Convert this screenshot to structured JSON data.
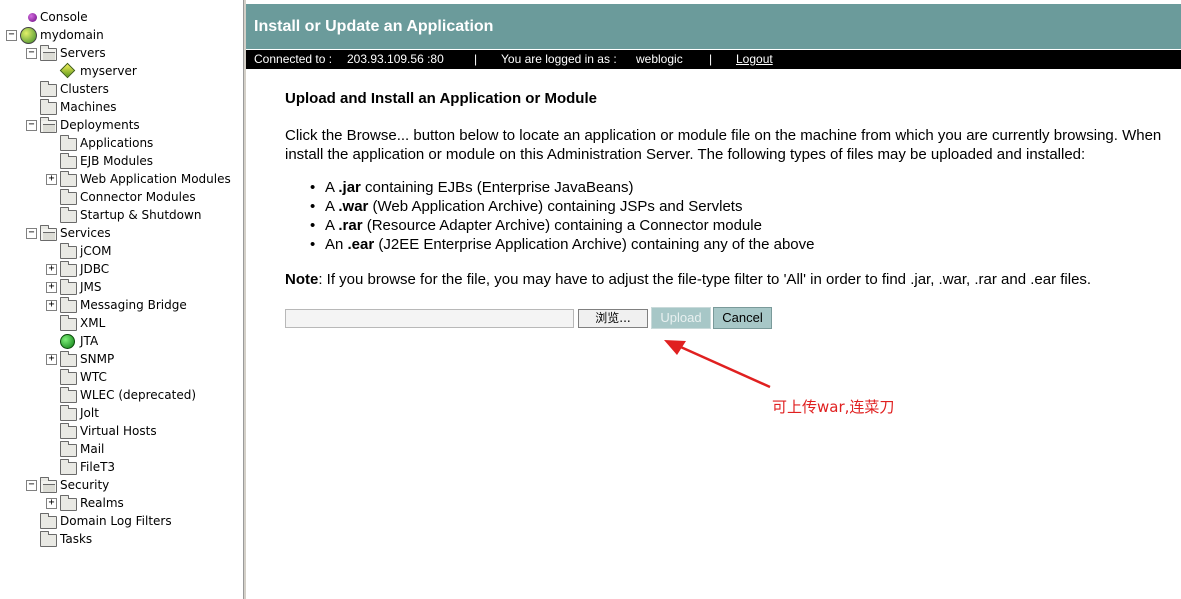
{
  "tree": {
    "items": [
      {
        "label": "Console",
        "icon": "console-dot-icon",
        "toggle": ""
      },
      {
        "label": "mydomain",
        "icon": "domain-globe-icon",
        "toggle": "⊟"
      },
      {
        "label": "Servers",
        "icon": "folder-open-icon",
        "toggle": "⊟"
      },
      {
        "label": "myserver",
        "icon": "server-diamond-icon",
        "toggle": ""
      },
      {
        "label": "Clusters",
        "icon": "folder-icon",
        "toggle": ""
      },
      {
        "label": "Machines",
        "icon": "folder-icon",
        "toggle": ""
      },
      {
        "label": "Deployments",
        "icon": "folder-open-icon",
        "toggle": "⊟"
      },
      {
        "label": "Applications",
        "icon": "folder-icon",
        "toggle": ""
      },
      {
        "label": "EJB Modules",
        "icon": "folder-icon",
        "toggle": ""
      },
      {
        "label": "Web Application Modules",
        "icon": "folder-icon",
        "toggle": "⊞"
      },
      {
        "label": "Connector Modules",
        "icon": "folder-icon",
        "toggle": ""
      },
      {
        "label": "Startup & Shutdown",
        "icon": "folder-icon",
        "toggle": ""
      },
      {
        "label": "Services",
        "icon": "folder-open-icon",
        "toggle": "⊟"
      },
      {
        "label": "jCOM",
        "icon": "folder-icon",
        "toggle": ""
      },
      {
        "label": "JDBC",
        "icon": "folder-icon",
        "toggle": "⊞"
      },
      {
        "label": "JMS",
        "icon": "folder-icon",
        "toggle": "⊞"
      },
      {
        "label": "Messaging Bridge",
        "icon": "folder-icon",
        "toggle": "⊞"
      },
      {
        "label": "XML",
        "icon": "folder-icon",
        "toggle": ""
      },
      {
        "label": "JTA",
        "icon": "green-ball-icon",
        "toggle": ""
      },
      {
        "label": "SNMP",
        "icon": "folder-icon",
        "toggle": "⊞"
      },
      {
        "label": "WTC",
        "icon": "folder-icon",
        "toggle": ""
      },
      {
        "label": "WLEC (deprecated)",
        "icon": "folder-icon",
        "toggle": ""
      },
      {
        "label": "Jolt",
        "icon": "folder-icon",
        "toggle": ""
      },
      {
        "label": "Virtual Hosts",
        "icon": "folder-icon",
        "toggle": ""
      },
      {
        "label": "Mail",
        "icon": "folder-icon",
        "toggle": ""
      },
      {
        "label": "FileT3",
        "icon": "folder-icon",
        "toggle": ""
      },
      {
        "label": "Security",
        "icon": "folder-open-icon",
        "toggle": "⊟"
      },
      {
        "label": "Realms",
        "icon": "folder-icon",
        "toggle": "⊞"
      },
      {
        "label": "Domain Log Filters",
        "icon": "folder-icon",
        "toggle": ""
      },
      {
        "label": "Tasks",
        "icon": "folder-icon",
        "toggle": ""
      }
    ]
  },
  "header": {
    "title": "Install or Update an Application",
    "connected_label": "Connected to :",
    "connected_value": "203.93.109.56 :80",
    "separator": "|",
    "logged_label": "You are logged in as :",
    "logged_value": "weblogic",
    "logout": "Logout"
  },
  "main": {
    "section_title": "Upload and Install an Application or Module",
    "intro": "Click the Browse... button below to locate an application or module file on the machine from which you are currently browsing. When install the application or module on this Administration Server. The following types of files may be uploaded and installed:",
    "file_types": [
      {
        "prefix": "A ",
        "ext": ".jar",
        "desc": " containing EJBs (Enterprise JavaBeans)"
      },
      {
        "prefix": "A ",
        "ext": ".war",
        "desc": " (Web Application Archive) containing JSPs and Servlets"
      },
      {
        "prefix": "A ",
        "ext": ".rar",
        "desc": " (Resource Adapter Archive) containing a Connector module"
      },
      {
        "prefix": "An ",
        "ext": ".ear",
        "desc": " (J2EE Enterprise Application Archive) containing any of the above"
      }
    ],
    "note_label": "Note",
    "note_text": ": If you browse for the file, you may have to adjust the file-type filter to 'All' in order to find .jar, .war, .rar and .ear files.",
    "file_input_value": "",
    "browse_label": "浏览...",
    "upload_label": "Upload",
    "cancel_label": "Cancel"
  },
  "annotation": {
    "text": "可上传war,连菜刀",
    "color": "#e02020"
  }
}
